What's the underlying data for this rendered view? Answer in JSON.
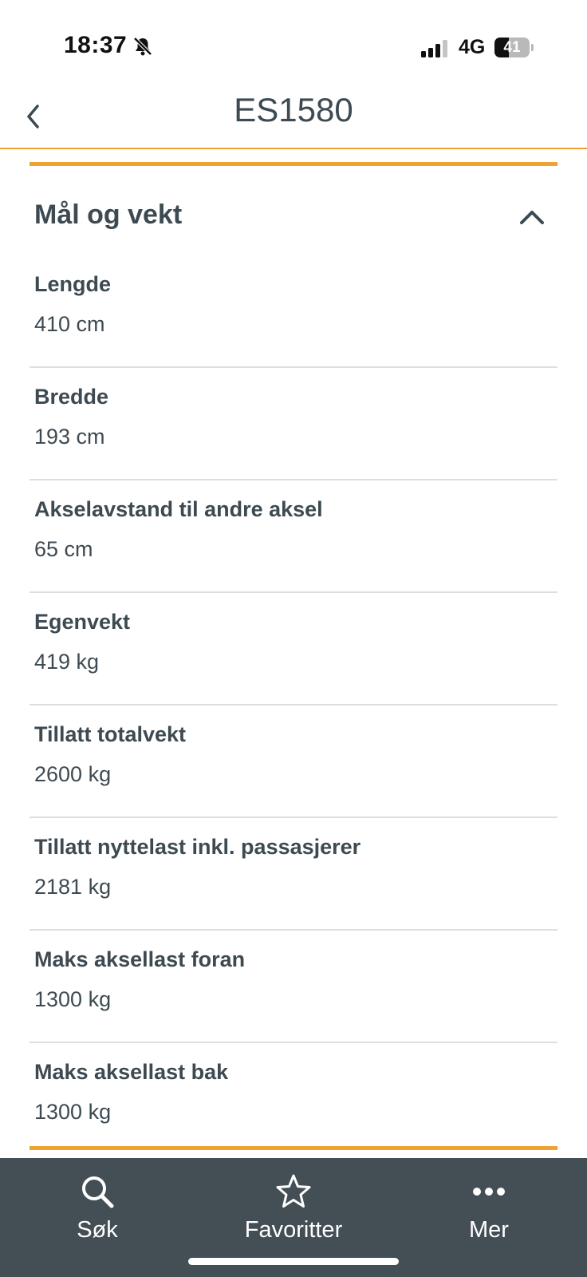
{
  "status_bar": {
    "time": "18:37",
    "network": "4G",
    "battery_level": "41",
    "battery_fraction": 0.41
  },
  "header": {
    "title": "ES1580",
    "back_icon": "chevron-left-icon"
  },
  "colors": {
    "accent": "#f0a133",
    "text": "#3d4a52",
    "tab_bar": "#444e55",
    "divider": "#dcdfe1"
  },
  "section": {
    "title": "Mål og vekt",
    "expanded": true,
    "toggle_icon": "chevron-up-icon",
    "items": [
      {
        "label": "Lengde",
        "value": "410 cm"
      },
      {
        "label": "Bredde",
        "value": "193 cm"
      },
      {
        "label": "Akselavstand til andre aksel",
        "value": "65 cm"
      },
      {
        "label": "Egenvekt",
        "value": "419 kg"
      },
      {
        "label": "Tillatt totalvekt",
        "value": "2600 kg"
      },
      {
        "label": "Tillatt nyttelast inkl. passasjerer",
        "value": "2181 kg"
      },
      {
        "label": "Maks aksellast foran",
        "value": "1300 kg"
      },
      {
        "label": "Maks aksellast bak",
        "value": "1300 kg"
      }
    ]
  },
  "tabs": [
    {
      "label": "Søk",
      "icon": "search-icon"
    },
    {
      "label": "Favoritter",
      "icon": "star-icon"
    },
    {
      "label": "Mer",
      "icon": "more-icon"
    }
  ]
}
